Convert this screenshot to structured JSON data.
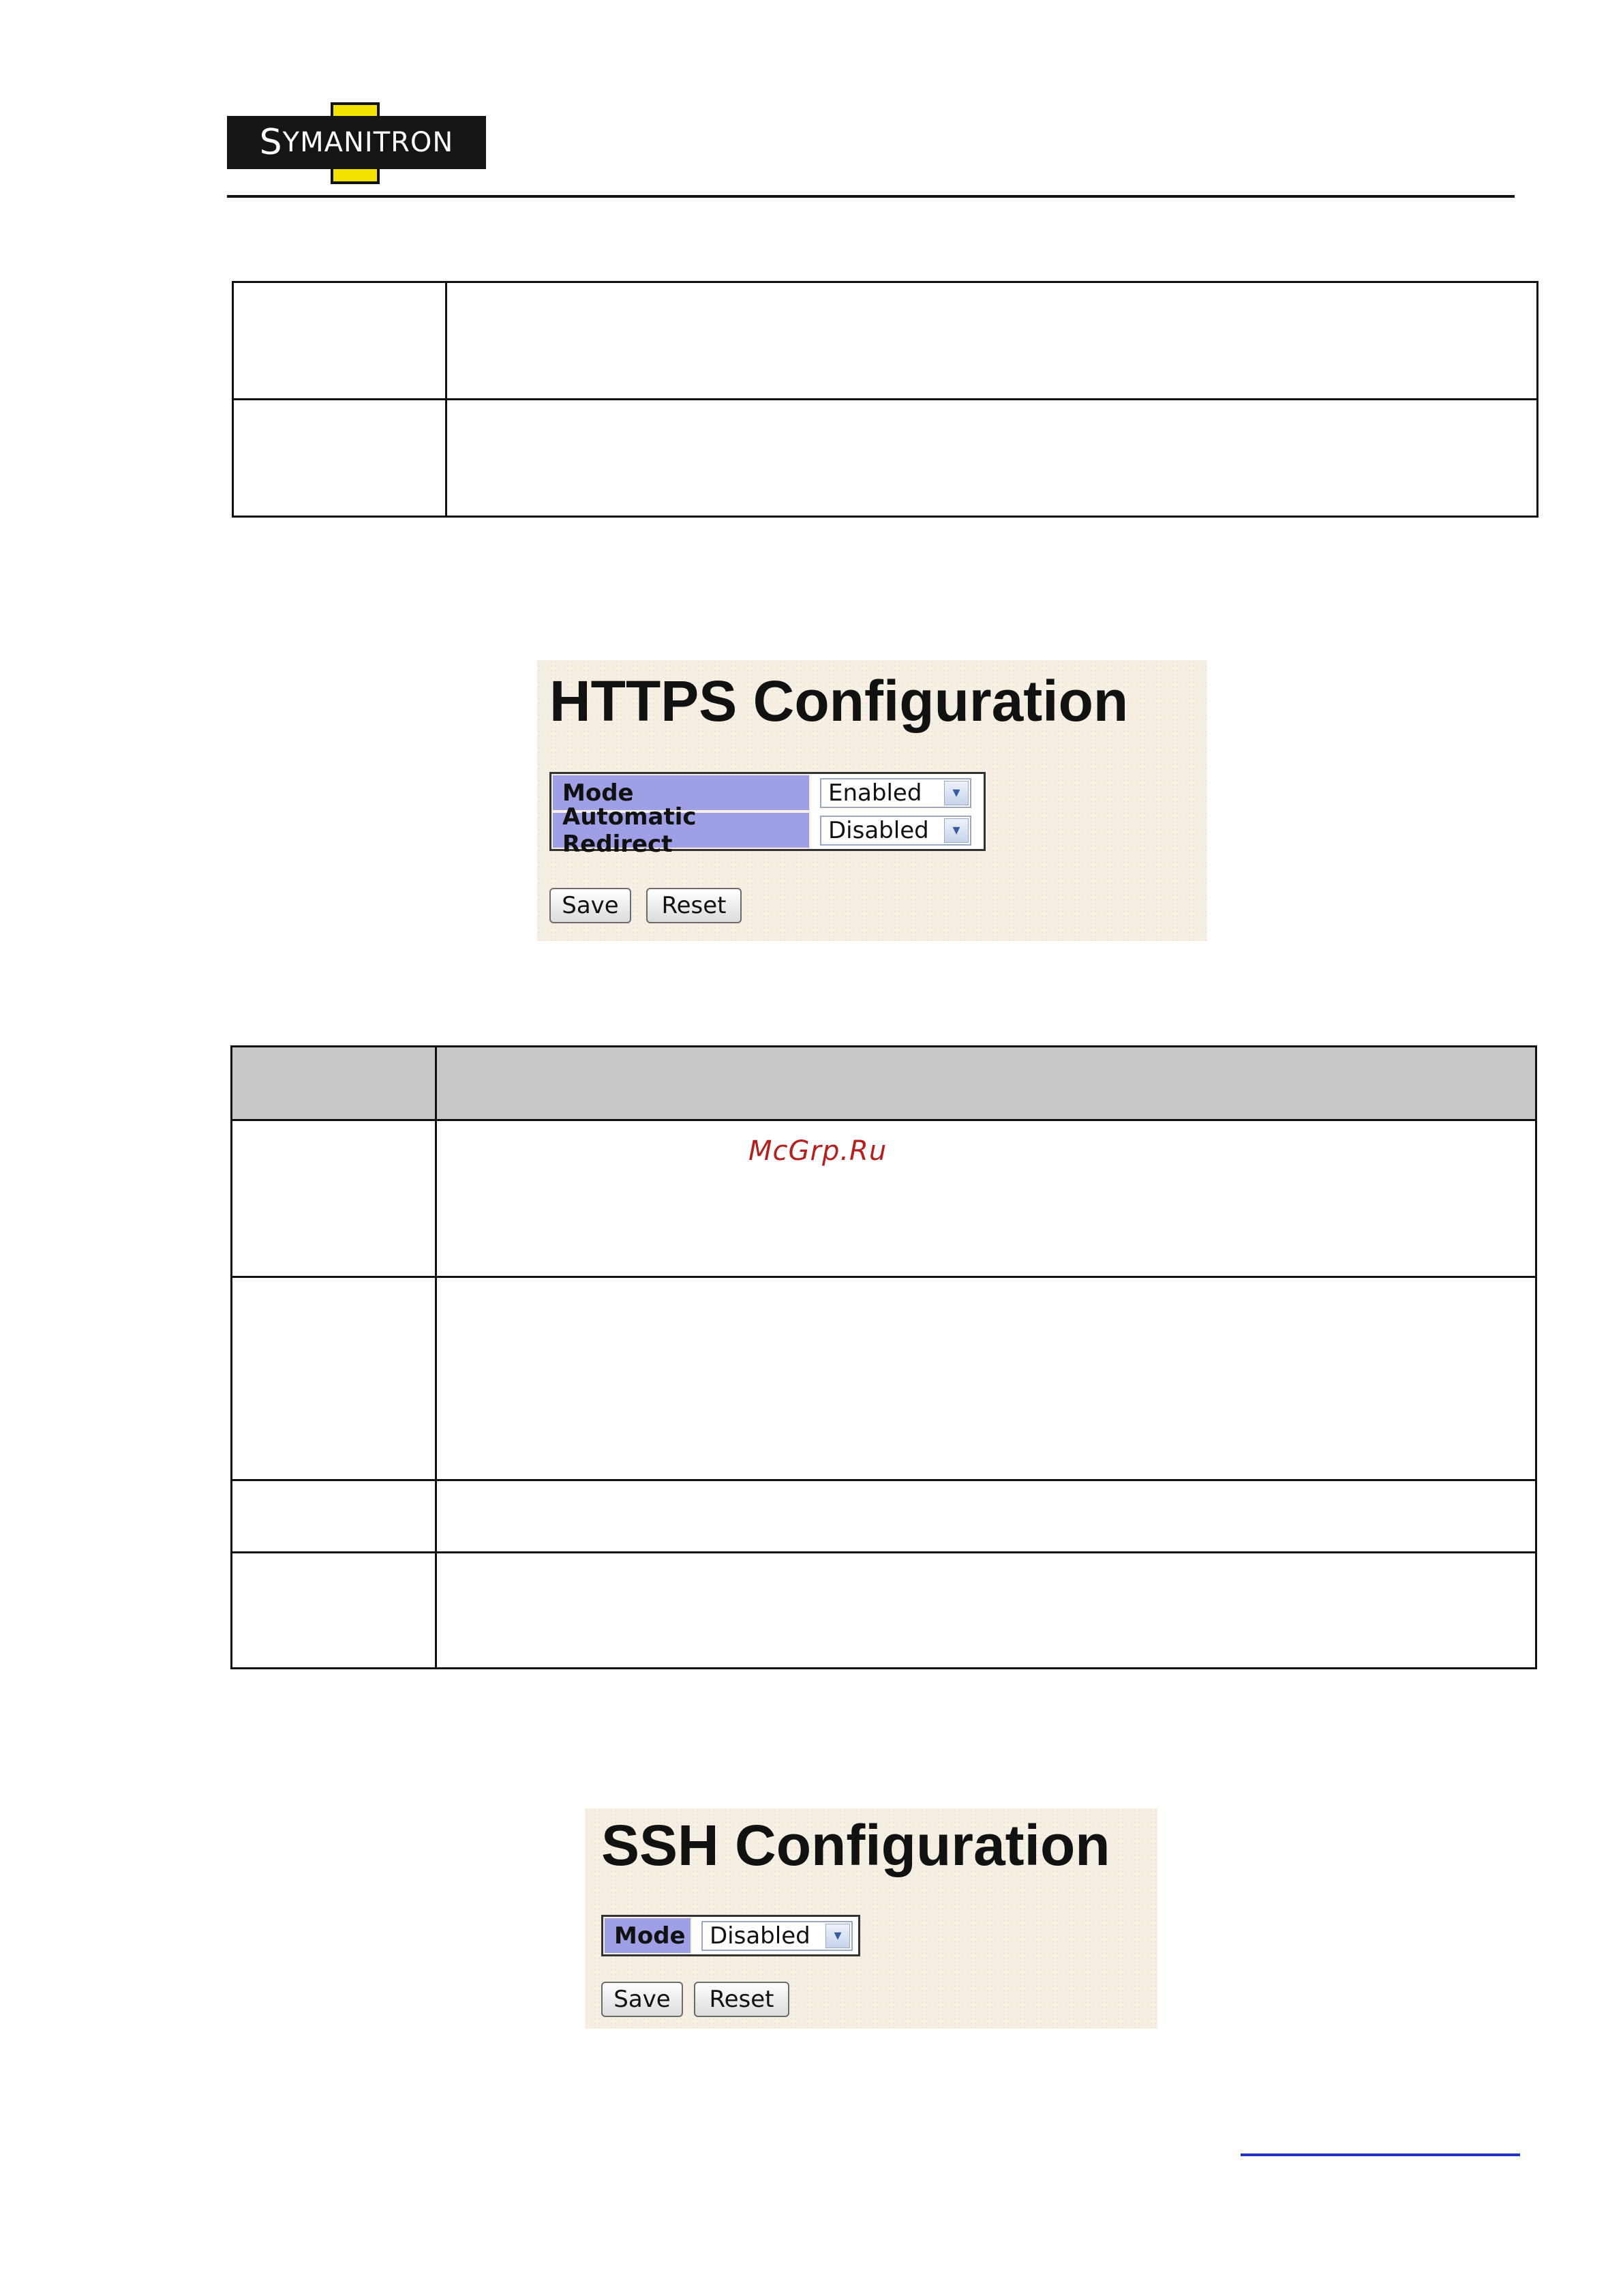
{
  "header": {
    "logo_text_first": "S",
    "logo_text_y": "Y",
    "logo_text_rest": "MANITRON"
  },
  "watermark": "McGrp.Ru",
  "https": {
    "title": "HTTPS Configuration",
    "rows": [
      {
        "label": "Mode",
        "value": "Enabled"
      },
      {
        "label": "Automatic Redirect",
        "value": "Disabled"
      }
    ],
    "save_label": "Save",
    "reset_label": "Reset"
  },
  "ssh": {
    "title": "SSH Configuration",
    "rows": [
      {
        "label": "Mode",
        "value": "Disabled"
      }
    ],
    "save_label": "Save",
    "reset_label": "Reset"
  },
  "colors": {
    "label_bg": "#9f9fe6",
    "panel_bg": "#f5efe4",
    "header_cell_bg": "#c8c8c8",
    "watermark": "#b22020"
  },
  "icons": {
    "select_arrow": "chevron-down-icon"
  }
}
